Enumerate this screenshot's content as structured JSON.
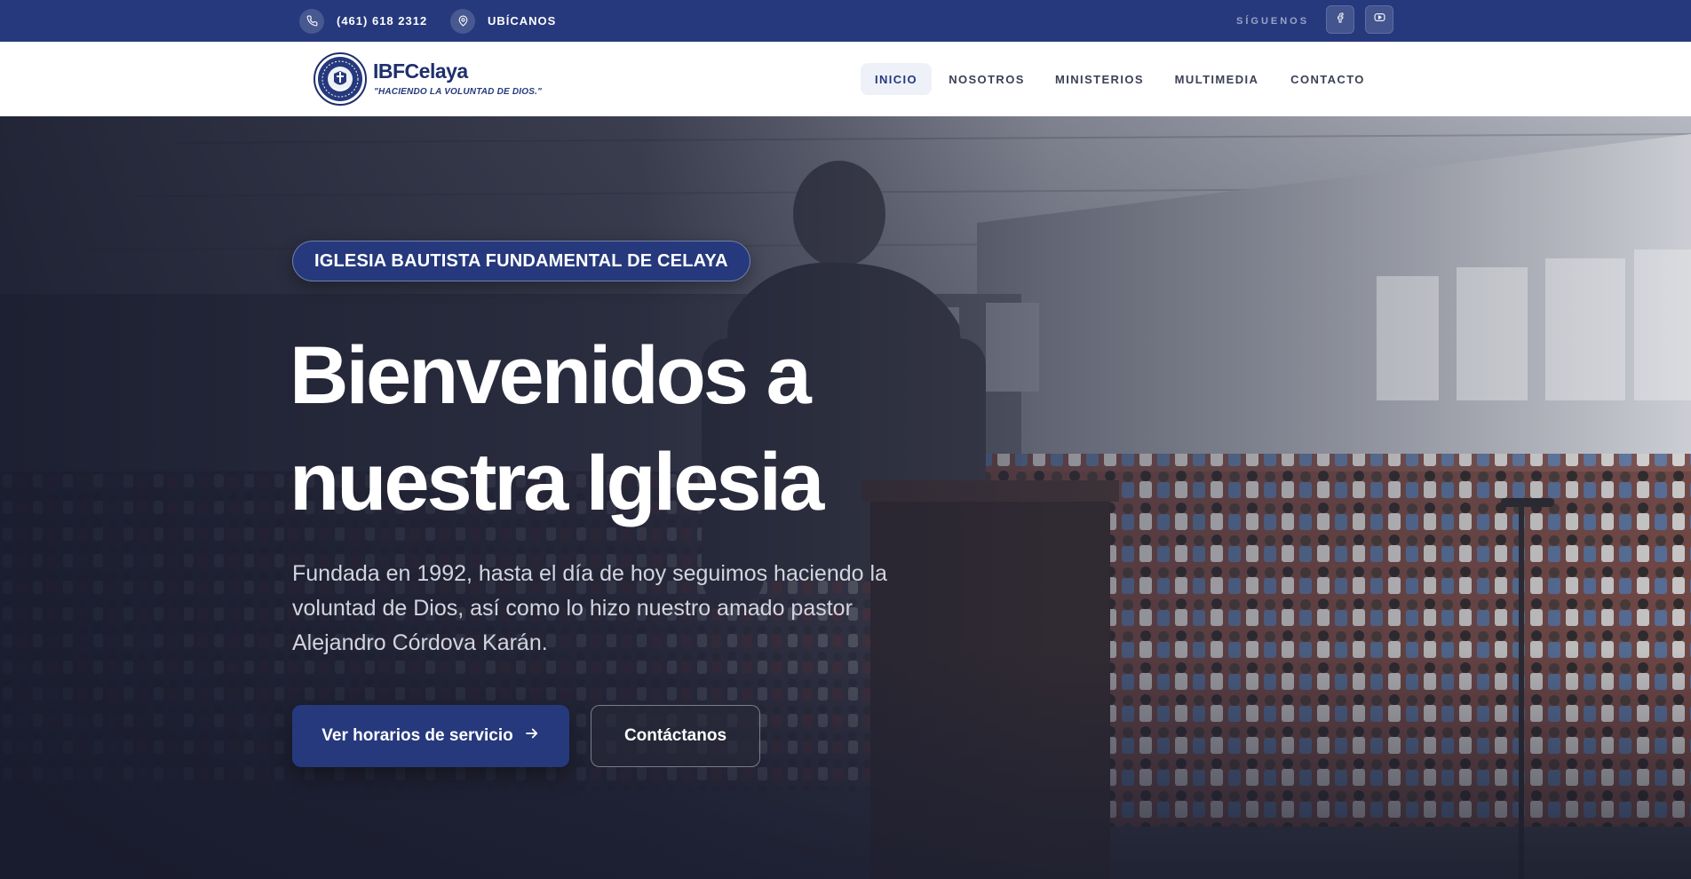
{
  "topbar": {
    "phone": "(461) 618 2312",
    "location": "UBÍCANOS",
    "follow_label": "SÍGUENOS",
    "phone_icon": "phone-icon",
    "location_icon": "map-pin-icon",
    "social": [
      "facebook-icon",
      "youtube-icon"
    ]
  },
  "brand": {
    "name": "IBFCelaya",
    "tagline": "\"HACIENDO LA VOLUNTAD DE DIOS.\"",
    "logo_icon": "church-seal-logo"
  },
  "nav": {
    "items": [
      "INICIO",
      "NOSOTROS",
      "MINISTERIOS",
      "MULTIMEDIA",
      "CONTACTO"
    ],
    "active": "INICIO"
  },
  "hero": {
    "badge": "IGLESIA BAUTISTA FUNDAMENTAL DE CELAYA",
    "title_line1": "Bienvenidos a",
    "title_line2": "nuestra Iglesia",
    "subtitle": "Fundada en 1992, hasta el día de hoy seguimos haciendo la voluntad de Dios, así como lo hizo nuestro amado pastor Alejandro Córdova Karán.",
    "primary_button": "Ver horarios de servicio",
    "primary_button_icon": "arrow-right-icon",
    "secondary_button": "Contáctanos"
  },
  "colors": {
    "brand_blue": "#26397d",
    "nav_text": "#3b4154",
    "white": "#ffffff"
  }
}
